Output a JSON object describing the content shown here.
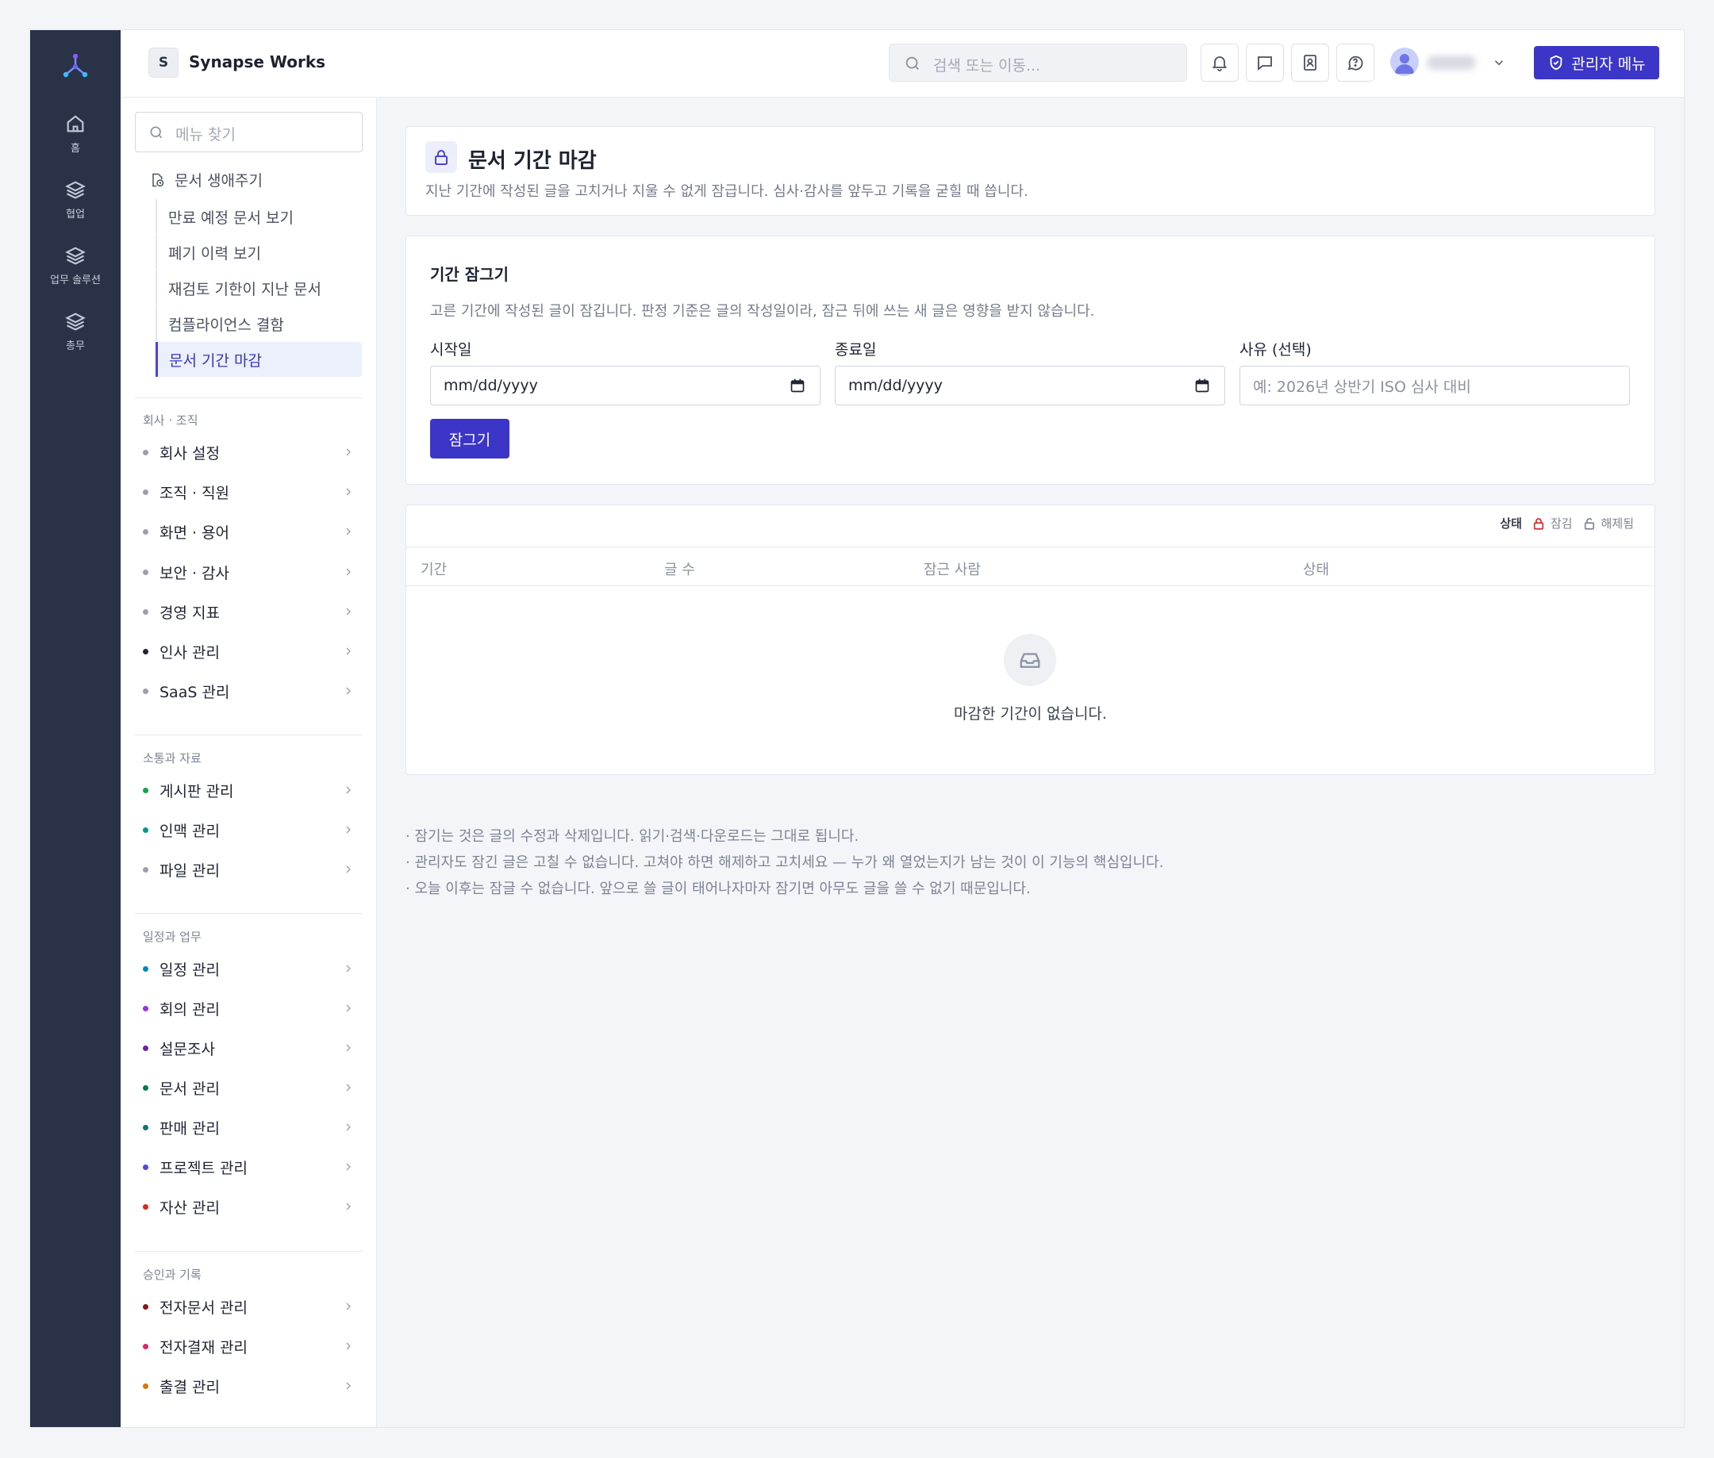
{
  "rail": {
    "items": [
      {
        "label": "홈",
        "icon": "home-icon"
      },
      {
        "label": "협업",
        "icon": "layers-icon"
      },
      {
        "label": "업무 솔루션",
        "icon": "layers-icon"
      },
      {
        "label": "총무",
        "icon": "layers-icon"
      }
    ]
  },
  "topbar": {
    "workspace_initial": "S",
    "workspace_name": "Synapse Works",
    "search_placeholder": "검색 또는 이동...",
    "admin_label": "관리자 메뉴"
  },
  "sidebar": {
    "search_placeholder": "메뉴 찾기",
    "lifecycle_title": "문서 생애주기",
    "lifecycle_items": [
      "만료 예정 문서 보기",
      "폐기 이력 보기",
      "재검토 기한이 지난 문서",
      "컴플라이언스 결함",
      "문서 기간 마감"
    ],
    "sections": [
      {
        "title": "회사 · 조직",
        "items": [
          {
            "label": "회사 설정",
            "color": "#9aa0ad"
          },
          {
            "label": "조직 · 직원",
            "color": "#9aa0ad"
          },
          {
            "label": "화면 · 용어",
            "color": "#9aa0ad"
          },
          {
            "label": "보안 · 감사",
            "color": "#9aa0ad"
          },
          {
            "label": "경영 지표",
            "color": "#9aa0ad"
          },
          {
            "label": "인사 관리",
            "color": "#1f2433"
          },
          {
            "label": "SaaS 관리",
            "color": "#9aa0ad"
          }
        ]
      },
      {
        "title": "소통과 자료",
        "items": [
          {
            "label": "게시판 관리",
            "color": "#16a34a"
          },
          {
            "label": "인맥 관리",
            "color": "#0d9488"
          },
          {
            "label": "파일 관리",
            "color": "#9aa0ad"
          }
        ]
      },
      {
        "title": "일정과 업무",
        "items": [
          {
            "label": "일정 관리",
            "color": "#0284c7"
          },
          {
            "label": "회의 관리",
            "color": "#9333ea"
          },
          {
            "label": "설문조사",
            "color": "#6b21a8"
          },
          {
            "label": "문서 관리",
            "color": "#047857"
          },
          {
            "label": "판매 관리",
            "color": "#0f766e"
          },
          {
            "label": "프로젝트 관리",
            "color": "#4f46e5"
          },
          {
            "label": "자산 관리",
            "color": "#dc2626"
          }
        ]
      },
      {
        "title": "승인과 기록",
        "items": [
          {
            "label": "전자문서 관리",
            "color": "#7f1d1d"
          },
          {
            "label": "전자결재 관리",
            "color": "#db2777"
          },
          {
            "label": "출결 관리",
            "color": "#d97706"
          }
        ]
      }
    ]
  },
  "page": {
    "title": "문서 기간 마감",
    "description": "지난 기간에 작성된 글을 고치거나 지울 수 없게 잠급니다. 심사·감사를 앞두고 기록을 굳힐 때 씁니다."
  },
  "lock_form": {
    "title": "기간 잠그기",
    "description": "고른 기간에 작성된 글이 잠깁니다. 판정 기준은 글의 작성일이라, 잠근 뒤에 쓰는 새 글은 영향을 받지 않습니다.",
    "start_label": "시작일",
    "start_value": "mm/dd/yyyy",
    "end_label": "종료일",
    "end_value": "mm/dd/yyyy",
    "reason_label": "사유 (선택)",
    "reason_placeholder": "예: 2026년 상반기 ISO 심사 대비",
    "submit_label": "잠그기"
  },
  "table": {
    "legend_title": "상태",
    "legend_locked": "잠김",
    "legend_unlocked": "해제됨",
    "columns": [
      "기간",
      "글 수",
      "잠근 사람",
      "상태"
    ],
    "empty_message": "마감한 기간이 없습니다."
  },
  "notes": [
    "· 잠기는 것은 글의 수정과 삭제입니다. 읽기·검색·다운로드는 그대로 됩니다.",
    "· 관리자도 잠긴 글은 고칠 수 없습니다. 고쳐야 하면 해제하고 고치세요 — 누가 왜 열었는지가 남는 것이 이 기능의 핵심입니다.",
    "· 오늘 이후는 잠글 수 없습니다. 앞으로 쓸 글이 태어나자마자 잠기면 아무도 글을 쓸 수 없기 때문입니다."
  ],
  "colors": {
    "accent": "#3b35c8",
    "rail_bg": "#2a3247",
    "locked": "#dc2626"
  }
}
